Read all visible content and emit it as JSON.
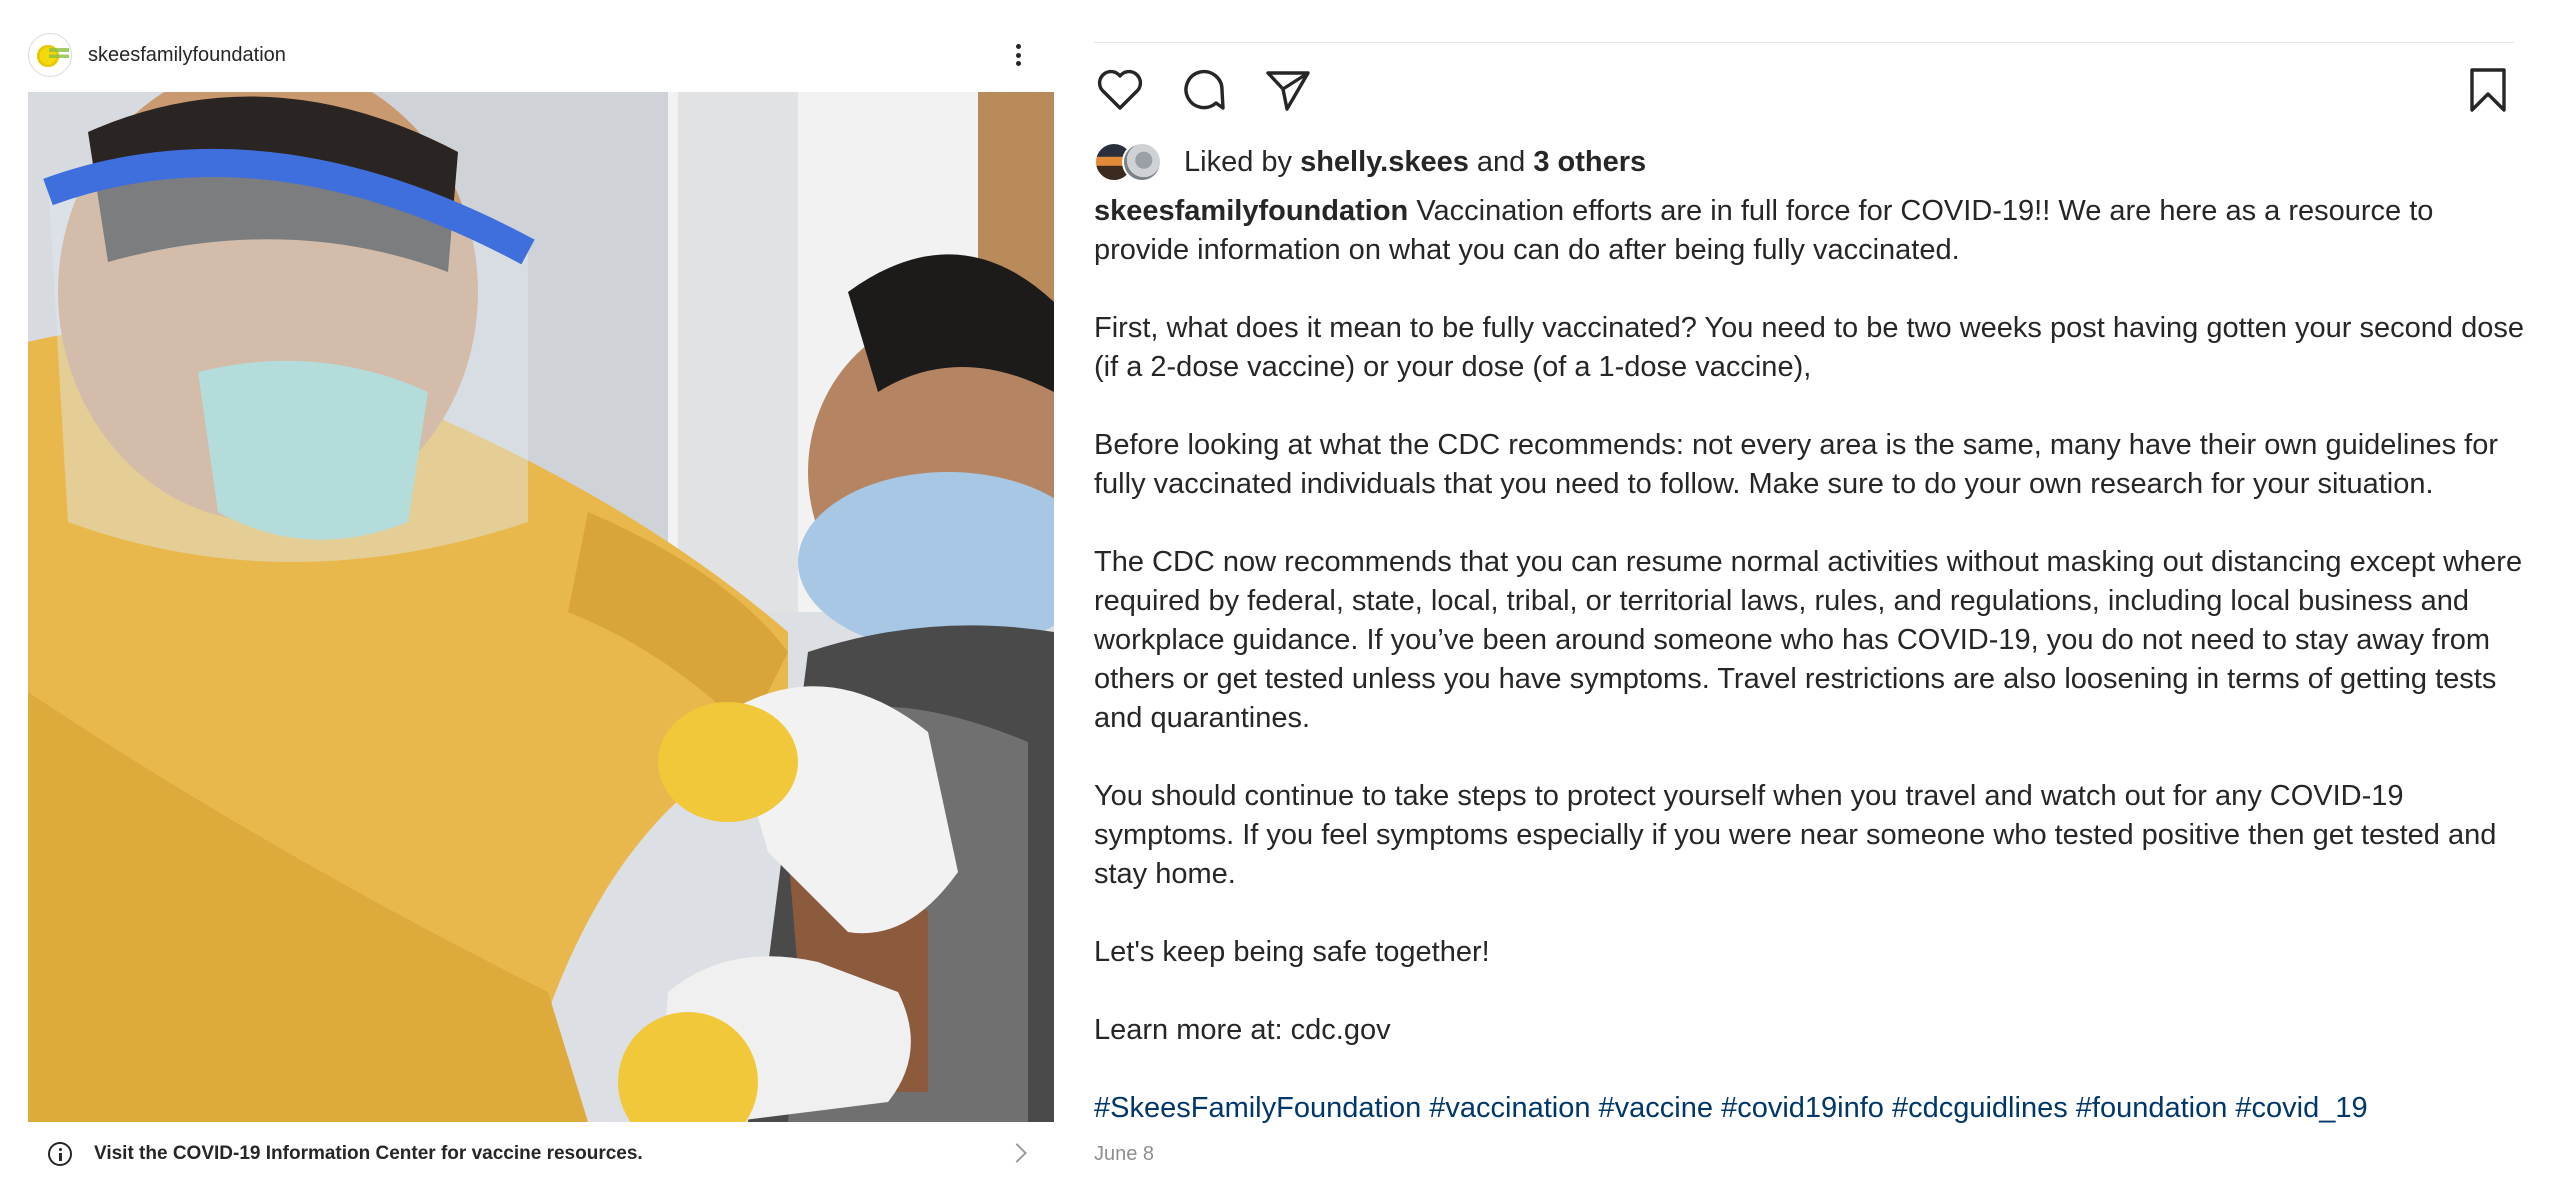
{
  "post": {
    "username": "skeesfamilyfoundation",
    "info_bar": "Visit the COVID-19 Information Center for vaccine resources.",
    "liked_by_prefix": "Liked by",
    "liked_by_user": "shelly.skees",
    "liked_by_and": "and",
    "liked_by_others": "3 others",
    "caption": {
      "user": "skeesfamilyfoundation",
      "intro": "Vaccination efforts are in full force for COVID-19!! We are here as a resource to provide information on what you can do after being fully vaccinated.",
      "p1": "First, what does it mean to be fully vaccinated? You need to be two weeks post having gotten your second dose (if a 2-dose vaccine) or your dose (of a 1-dose vaccine),",
      "p2": "Before looking at what the CDC recommends: not every area is the same, many have their own guidelines for fully vaccinated individuals that you need to follow. Make sure to do your own research for your situation.",
      "p3": "The CDC now recommends that you can resume normal activities without masking out distancing except where required by federal, state, local, tribal, or territorial laws, rules, and regulations, including local business and workplace guidance. If you’ve been around someone who has COVID-19, you do not need to stay away from others or get tested unless you have symptoms. Travel restrictions are also loosening in terms of getting tests and quarantines.",
      "p4": "You should continue to take steps to protect yourself when you travel and watch out for any COVID-19 symptoms. If you feel symptoms especially if you were near someone who tested positive then get tested and stay home.",
      "p5": "Let's keep being safe together!",
      "p6": "Learn more at: cdc.gov",
      "hashtags": "#SkeesFamilyFoundation #vaccination #vaccine #covid19info #cdcguidlines #foundation #covid_19"
    },
    "date": "June 8"
  },
  "icons": {
    "more": "more-options-icon",
    "like": "heart-icon",
    "comment": "comment-icon",
    "share": "share-icon",
    "save": "bookmark-icon",
    "info": "info-icon",
    "chevron": "chevron-right-icon"
  },
  "colors": {
    "text": "#262626",
    "hashtag": "#00376b",
    "muted": "#8e8e8e"
  }
}
